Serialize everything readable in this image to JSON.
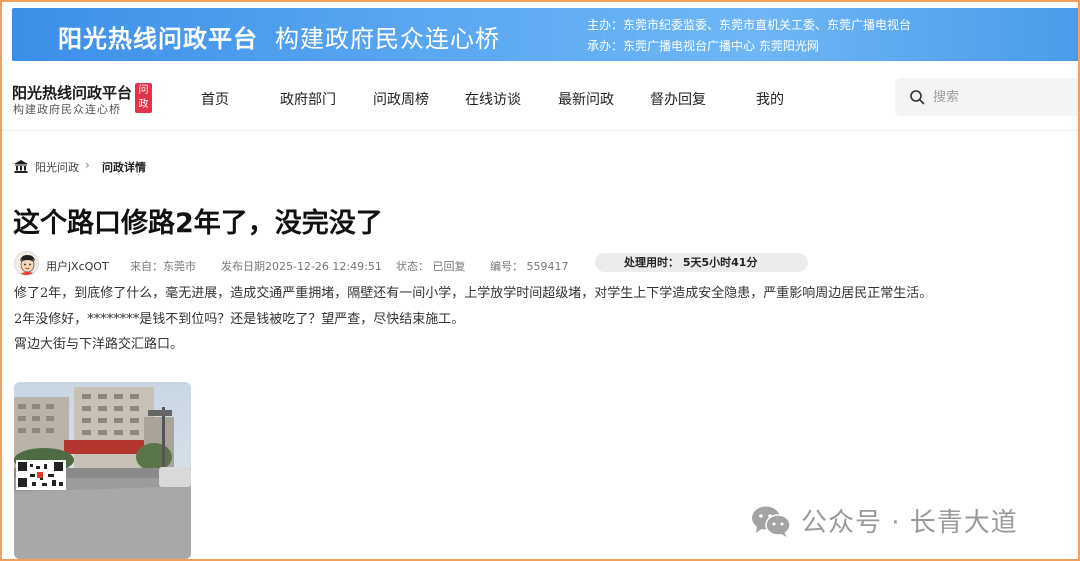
{
  "banner": {
    "title": "阳光热线问政平台",
    "subtitle": "构建政府民众连心桥",
    "host": "主办：东莞市纪委监委、东莞市直机关工委、东莞广播电视台",
    "organizer": "承办：东莞广播电视台广播中心 东莞阳光网"
  },
  "logo": {
    "title": "阳光热线问政平台",
    "subtitle": "构建政府民众连心桥",
    "badge": "问政"
  },
  "nav": {
    "items": [
      "首页",
      "政府部门",
      "问政周榜",
      "在线访谈",
      "最新问政",
      "督办回复",
      "我的"
    ]
  },
  "search": {
    "placeholder": "搜索"
  },
  "breadcrumb": {
    "root": "阳光问政",
    "separator": "›",
    "current": "问政详情"
  },
  "post": {
    "title": "这个路口修路2年了，没完没了",
    "user": "用户jXcQOT",
    "from": "来自：东莞市",
    "date": "发布日期2025-12-26 12:49:51",
    "status": "状态：  已回复",
    "number": "编号：  559417",
    "elapsed": "处理用时：  5天5小时41分",
    "paragraphs": [
      "修了2年，到底修了什么，毫无进展，造成交通严重拥堵，隔壁还有一间小学，上学放学时间超级堵，对学生上下学造成安全隐患，严重影响周边居民正常生活。",
      "2年没修好，********是钱不到位吗？还是钱被吃了？望严查，尽快结束施工。",
      "霄边大街与下洋路交汇路口。"
    ]
  },
  "watermark": {
    "text": "公众号 · 长青大道"
  },
  "colors": {
    "banner_blue": "#4a9be9",
    "badge_red": "#e2334a",
    "frame_orange": "#f0a05a"
  },
  "icons": {
    "search": "magnifier-icon",
    "breadcrumb_home": "bank-building-icon",
    "watermark": "wechat-icon"
  }
}
